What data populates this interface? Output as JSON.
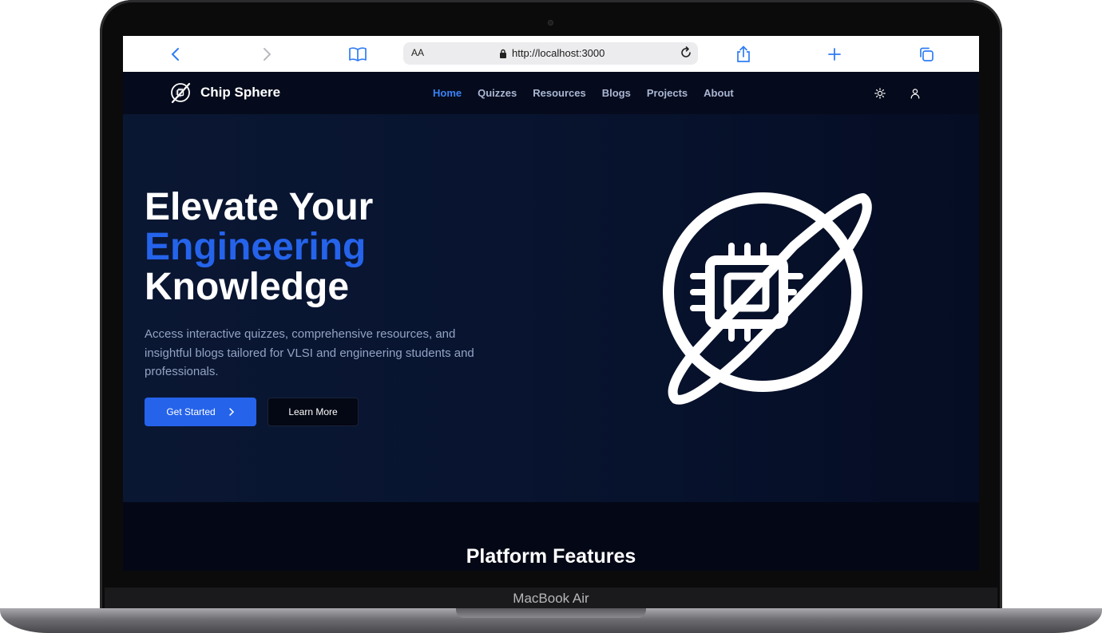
{
  "device": {
    "label": "MacBook Air"
  },
  "browser": {
    "text_size_label": "AA",
    "url": "http://localhost:3000"
  },
  "site": {
    "brand": "Chip Sphere",
    "nav": [
      {
        "label": "Home",
        "active": true
      },
      {
        "label": "Quizzes",
        "active": false
      },
      {
        "label": "Resources",
        "active": false
      },
      {
        "label": "Blogs",
        "active": false
      },
      {
        "label": "Projects",
        "active": false
      },
      {
        "label": "About",
        "active": false
      }
    ],
    "icons": [
      "sun-icon",
      "user-icon"
    ]
  },
  "hero": {
    "title_line1": "Elevate Your",
    "title_accent": "Engineering",
    "title_line3": "Knowledge",
    "description": "Access interactive quizzes, comprehensive resources, and insightful blogs tailored for VLSI and engineering students and professionals.",
    "primary_button": "Get Started",
    "secondary_button": "Learn More"
  },
  "features": {
    "title": "Platform Features"
  },
  "colors": {
    "accent": "#2563eb",
    "nav_active": "#3b82f6",
    "background": "#050b1c"
  }
}
